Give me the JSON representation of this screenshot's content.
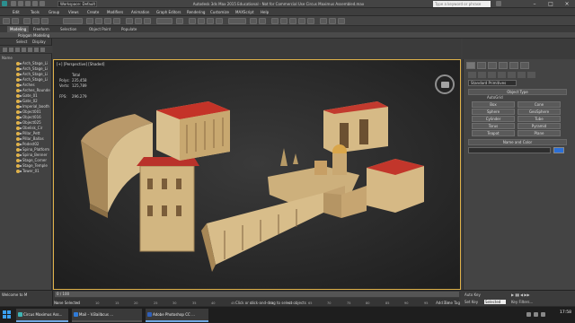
{
  "window": {
    "workspace": "Workspace: Default",
    "title": "Autodesk 3ds Max 2015 Educational - Not for Commercial Use    Circus Maximus Assembled.max",
    "search_placeholder": "Type a keyword or phrase"
  },
  "menu": [
    "Edit",
    "Tools",
    "Group",
    "Views",
    "Create",
    "Modifiers",
    "Animation",
    "Graph Editors",
    "Rendering",
    "Customize",
    "MAXScript",
    "Help"
  ],
  "ribbon": {
    "tabs": [
      "Modeling",
      "Freeform",
      "Selection",
      "Object Paint",
      "Populate"
    ],
    "active_tab": "Modeling",
    "panel": "Polygon Modeling"
  },
  "scene_explorer": {
    "tabs": [
      "Select",
      "Display"
    ],
    "header": "Name",
    "items": [
      "Arch_Stage_Li",
      "Arch_Stage_Li",
      "Arch_Stage_Li",
      "Arch_Stage_Li",
      "Arches",
      "Arches_Rounde",
      "Gate_01",
      "Gate_02",
      "Imperial_booth",
      "Object001",
      "Object016",
      "Object025",
      "Obelisk_Cir",
      "Pillar_Pett",
      "Pillar_Ballas",
      "Podest02",
      "Spina_Platform",
      "Spina_Benner",
      "Stage_Corner",
      "Stage_Temple",
      "Tower_01"
    ]
  },
  "viewport": {
    "label": "[+] [Perspective] [Shaded]",
    "stats": {
      "header": "Total",
      "polys_label": "Polys:",
      "polys": "235,458",
      "verts_label": "Verts:",
      "verts": "125,789",
      "fps_label": "FPS:",
      "fps": "296.279"
    }
  },
  "command_panel": {
    "category": "Standard Primitives",
    "object_type_title": "Object Type",
    "autogrid": "AutoGrid",
    "buttons": [
      "Box",
      "Cone",
      "Sphere",
      "GeoSphere",
      "Cylinder",
      "Tube",
      "Torus",
      "Pyramid",
      "Teapot",
      "Plane"
    ],
    "name_color_title": "Name and Color",
    "swatch_color": "#2b6fd6"
  },
  "timeline": {
    "frame": "0 / 100",
    "ticks": [
      "0",
      "5",
      "10",
      "15",
      "20",
      "25",
      "30",
      "35",
      "40",
      "45",
      "50",
      "55",
      "60",
      "65",
      "70",
      "75",
      "80",
      "85",
      "90",
      "95",
      "100"
    ]
  },
  "status": {
    "welcome": "Welcome to M",
    "objects": "None Selected",
    "prompt": "Click or click-and-drag to select objects",
    "autokey": "Auto Key",
    "selected": "Selected",
    "setkey": "Set Key",
    "keyfilters": "Key Filters...",
    "addtimetag": "Add Time Tag"
  },
  "taskbar": {
    "tasks": [
      {
        "label": "Circus Maximus Ass...",
        "color": "#3fb4b4"
      },
      {
        "label": "Mail – V.Bailbcus ...",
        "color": "#2f7bd8"
      },
      {
        "label": "Adobe Photoshop CC ...",
        "color": "#2f5fb8"
      }
    ],
    "clock": "17:58"
  }
}
